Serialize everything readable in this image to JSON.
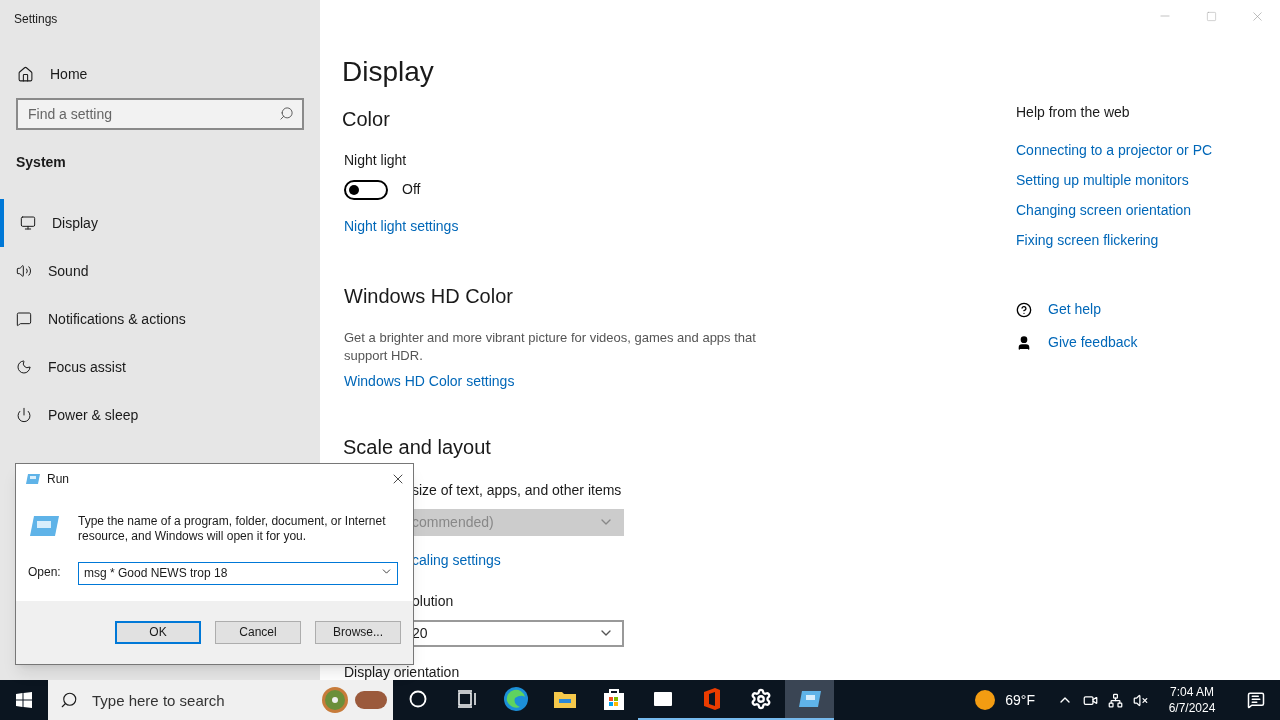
{
  "window": {
    "title": "Settings"
  },
  "sidebar": {
    "home": "Home",
    "search": {
      "placeholder": "Find a setting"
    },
    "section": "System",
    "items": [
      {
        "label": "Display",
        "selected": true
      },
      {
        "label": "Sound",
        "selected": false
      },
      {
        "label": "Notifications & actions",
        "selected": false
      },
      {
        "label": "Focus assist",
        "selected": false
      },
      {
        "label": "Power & sleep",
        "selected": false
      }
    ]
  },
  "page": {
    "title": "Display",
    "color_heading": "Color",
    "night_light": {
      "label": "Night light",
      "on": false,
      "state_text": "Off"
    },
    "night_light_link": "Night light settings",
    "hd_heading": "Windows HD Color",
    "hd_text": "Get a brighter and more vibrant picture for videos, games and apps that support HDR.",
    "hd_link": "Windows HD Color settings",
    "scale_heading": "Scale and layout",
    "scale_label": "size of text, apps, and other items",
    "scale_value": "commended)",
    "scale_link": "caling settings",
    "resolution_label": "olution",
    "resolution_value": "20",
    "orientation_label": "Display orientation"
  },
  "help": {
    "heading": "Help from the web",
    "links": [
      "Connecting to a projector or PC",
      "Setting up multiple monitors",
      "Changing screen orientation",
      "Fixing screen flickering"
    ],
    "actions": [
      {
        "label": "Get help",
        "kind": "help"
      },
      {
        "label": "Give feedback",
        "kind": "feedback"
      }
    ]
  },
  "run_dialog": {
    "title": "Run",
    "text": "Type the name of a program, folder, document, or Internet resource, and Windows will open it for you.",
    "open_label": "Open:",
    "value": "msg * Good NEWS trop 18",
    "buttons": [
      "OK",
      "Cancel",
      "Browse..."
    ]
  },
  "taskbar": {
    "search_placeholder": "Type here to search",
    "apps": [
      {
        "kind": "cortana",
        "running": false,
        "selected": false
      },
      {
        "kind": "taskview",
        "running": false,
        "selected": false
      },
      {
        "kind": "edge",
        "running": false,
        "selected": false
      },
      {
        "kind": "explorer",
        "running": false,
        "selected": false
      },
      {
        "kind": "store",
        "running": false,
        "selected": false
      },
      {
        "kind": "mail",
        "running": true,
        "selected": false
      },
      {
        "kind": "office",
        "running": true,
        "selected": false
      },
      {
        "kind": "settings",
        "running": true,
        "selected": false
      },
      {
        "kind": "run",
        "running": true,
        "selected": true
      }
    ],
    "weather": "69°F",
    "time": "7:04 AM",
    "date": "6/7/2024"
  }
}
